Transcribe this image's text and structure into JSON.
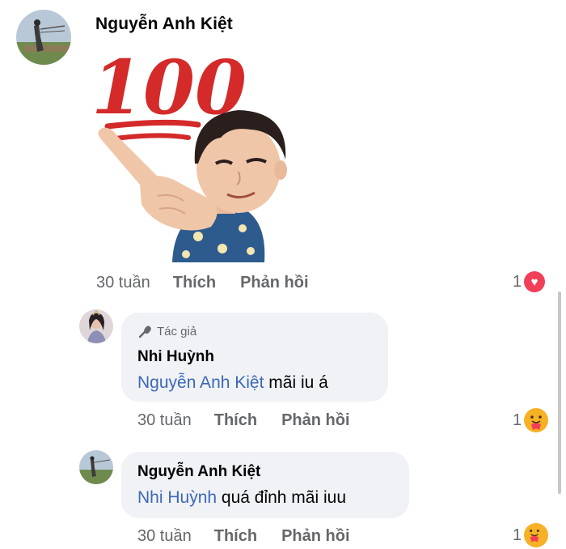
{
  "comment": {
    "author": "Nguyễn Anh Kiệt",
    "sticker": "100-emoji-pointing-sticker",
    "sticker_text": "100",
    "time": "30 tuần",
    "like_label": "Thích",
    "reply_label": "Phản hồi",
    "reaction_count": "1",
    "reaction_icon": "heart-icon"
  },
  "replies": [
    {
      "author_badge": "Tác giả",
      "author": "Nhi Huỳnh",
      "mention": "Nguyễn Anh Kiệt",
      "text": " mãi iu á",
      "time": "30 tuần",
      "like_label": "Thích",
      "reply_label": "Phản hồi",
      "reaction_count": "1",
      "reaction_icon": "care-icon"
    },
    {
      "author": "Nguyễn Anh Kiệt",
      "mention": "Nhi Huỳnh",
      "text": " quá đỉnh mãi iuu",
      "time": "30 tuần",
      "like_label": "Thích",
      "reply_label": "Phản hồi",
      "reaction_count": "1",
      "reaction_icon": "care-icon"
    }
  ],
  "colors": {
    "mention": "#3c68b8",
    "meta": "#65676b",
    "bubble": "#f0f2f5",
    "heart": "#f33e58",
    "care": "#f7b125",
    "sticker_red": "#d42a2a"
  }
}
